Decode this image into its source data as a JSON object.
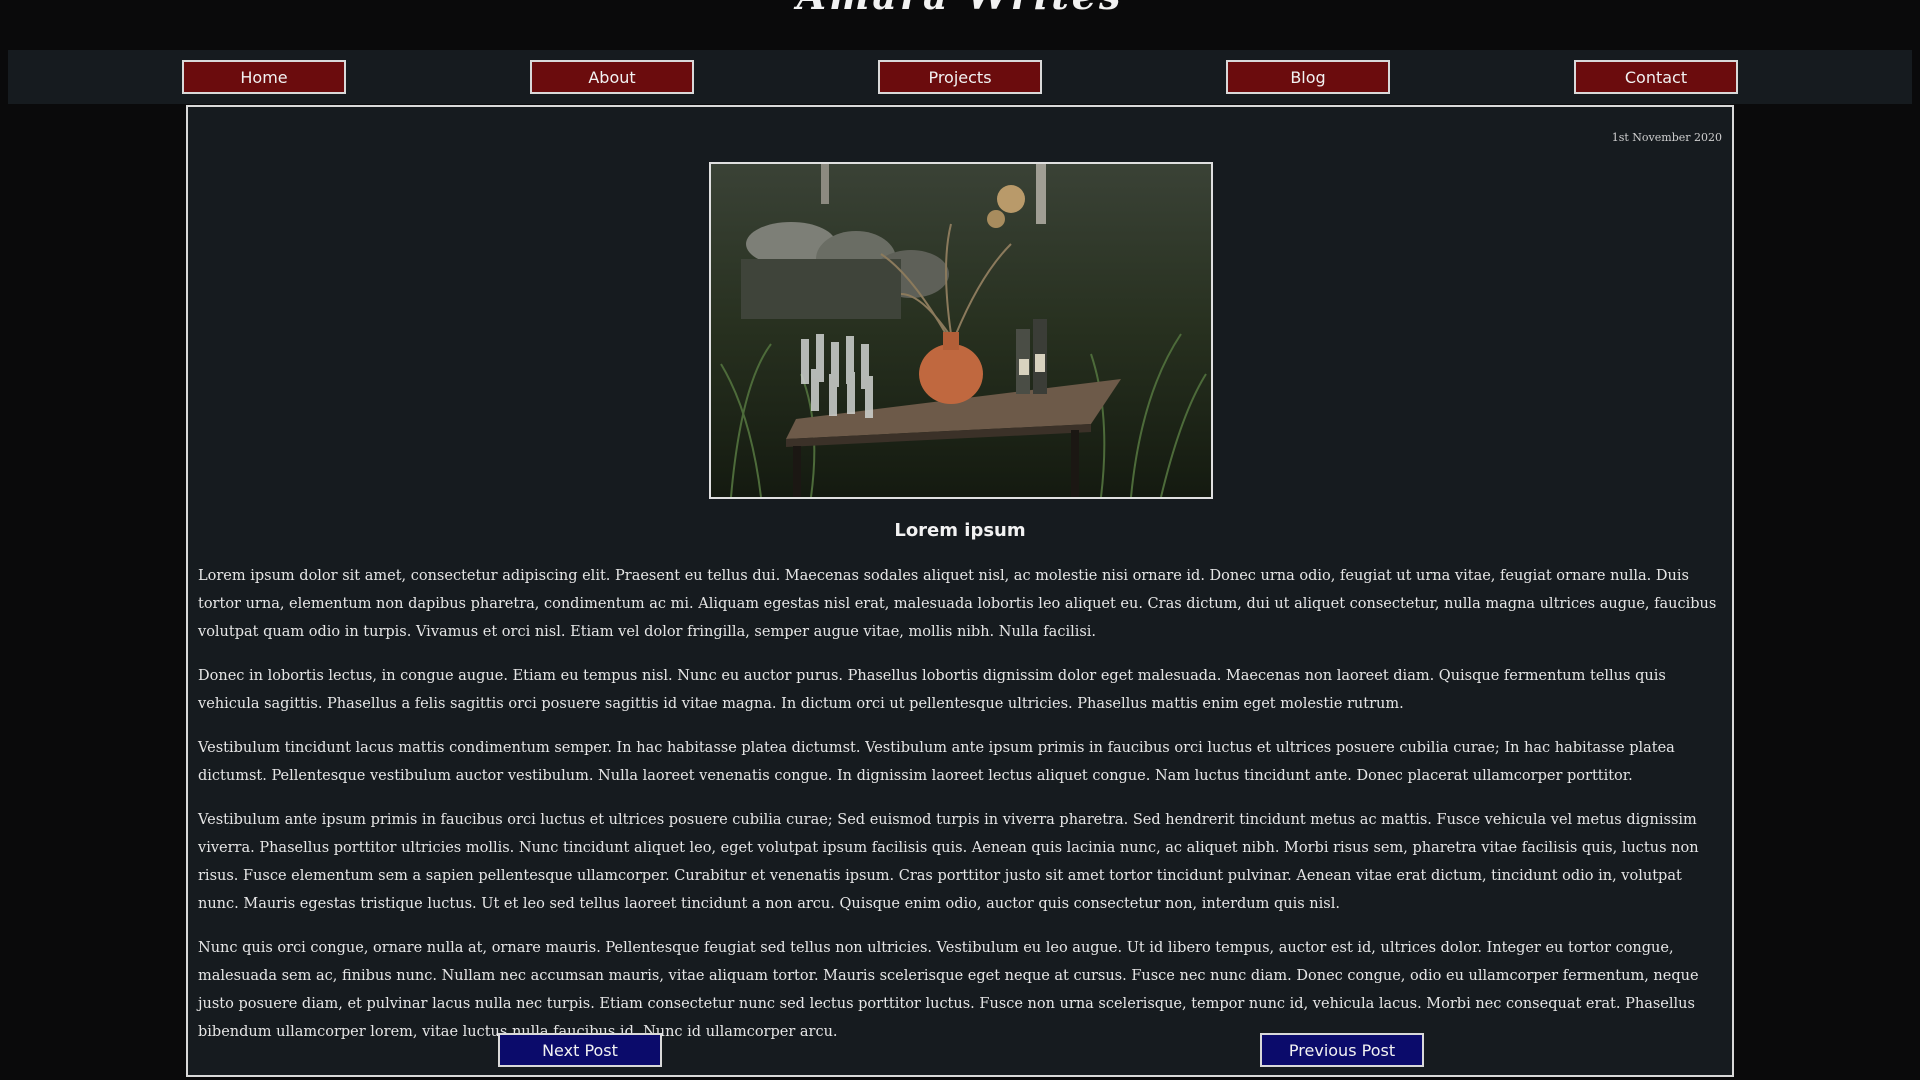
{
  "site": {
    "title": "Amara Writes"
  },
  "nav": {
    "items": [
      {
        "label": "Home"
      },
      {
        "label": "About"
      },
      {
        "label": "Projects"
      },
      {
        "label": "Blog"
      },
      {
        "label": "Contact"
      }
    ]
  },
  "post": {
    "date": "1st November 2020",
    "image_icon": "photo-of-table-with-vase-and-glasses",
    "title": "Lorem ipsum",
    "paragraphs": [
      "Lorem ipsum dolor sit amet, consectetur adipiscing elit. Praesent eu tellus dui. Maecenas sodales aliquet nisl, ac molestie nisi ornare id. Donec urna odio, feugiat ut urna vitae, feugiat ornare nulla. Duis tortor urna, elementum non dapibus pharetra, condimentum ac mi. Aliquam egestas nisl erat, malesuada lobortis leo aliquet eu. Cras dictum, dui ut aliquet consectetur, nulla magna ultrices augue, faucibus volutpat quam odio in turpis. Vivamus et orci nisl. Etiam vel dolor fringilla, semper augue vitae, mollis nibh. Nulla facilisi.",
      "Donec in lobortis lectus, in congue augue. Etiam eu tempus nisl. Nunc eu auctor purus. Phasellus lobortis dignissim dolor eget malesuada. Maecenas non laoreet diam. Quisque fermentum tellus quis vehicula sagittis. Phasellus a felis sagittis orci posuere sagittis id vitae magna. In dictum orci ut pellentesque ultricies. Phasellus mattis enim eget molestie rutrum.",
      "Vestibulum tincidunt lacus mattis condimentum semper. In hac habitasse platea dictumst. Vestibulum ante ipsum primis in faucibus orci luctus et ultrices posuere cubilia curae; In hac habitasse platea dictumst. Pellentesque vestibulum auctor vestibulum. Nulla laoreet venenatis congue. In dignissim laoreet lectus aliquet congue. Nam luctus tincidunt ante. Donec placerat ullamcorper porttitor.",
      "Vestibulum ante ipsum primis in faucibus orci luctus et ultrices posuere cubilia curae; Sed euismod turpis in viverra pharetra. Sed hendrerit tincidunt metus ac mattis. Fusce vehicula vel metus dignissim viverra. Phasellus porttitor ultricies mollis. Nunc tincidunt aliquet leo, eget volutpat ipsum facilisis quis. Aenean quis lacinia nunc, ac aliquet nibh. Morbi risus sem, pharetra vitae facilisis quis, luctus non risus. Fusce elementum sem a sapien pellentesque ullamcorper. Curabitur et venenatis ipsum. Cras porttitor justo sit amet tortor tincidunt pulvinar. Aenean vitae erat dictum, tincidunt odio in, volutpat nunc. Mauris egestas tristique luctus. Ut et leo sed tellus laoreet tincidunt a non arcu. Quisque enim odio, auctor quis consectetur non, interdum quis nisl.",
      "Nunc quis orci congue, ornare nulla at, ornare mauris. Pellentesque feugiat sed tellus non ultricies. Vestibulum eu leo augue. Ut id libero tempus, auctor est id, ultrices dolor. Integer eu tortor congue, malesuada sem ac, finibus nunc. Nullam nec accumsan mauris, vitae aliquam tortor. Mauris scelerisque eget neque at cursus. Fusce nec nunc diam. Donec congue, odio eu ullamcorper fermentum, neque justo posuere diam, et pulvinar lacus nulla nec turpis. Etiam consectetur nunc sed lectus porttitor luctus. Fusce non urna scelerisque, tempor nunc id, vehicula lacus. Morbi nec consequat erat. Phasellus bibendum ullamcorper lorem, vitae luctus nulla faucibus id. Nunc id ullamcorper arcu."
    ],
    "next_label": "Next Post",
    "previous_label": "Previous Post"
  },
  "colors": {
    "page_background": "#0a0a0b",
    "panel_background": "#161b1f",
    "nav_button": "#6b0c0d",
    "post_button": "#0b0b6b",
    "border": "#d9d9d9"
  }
}
